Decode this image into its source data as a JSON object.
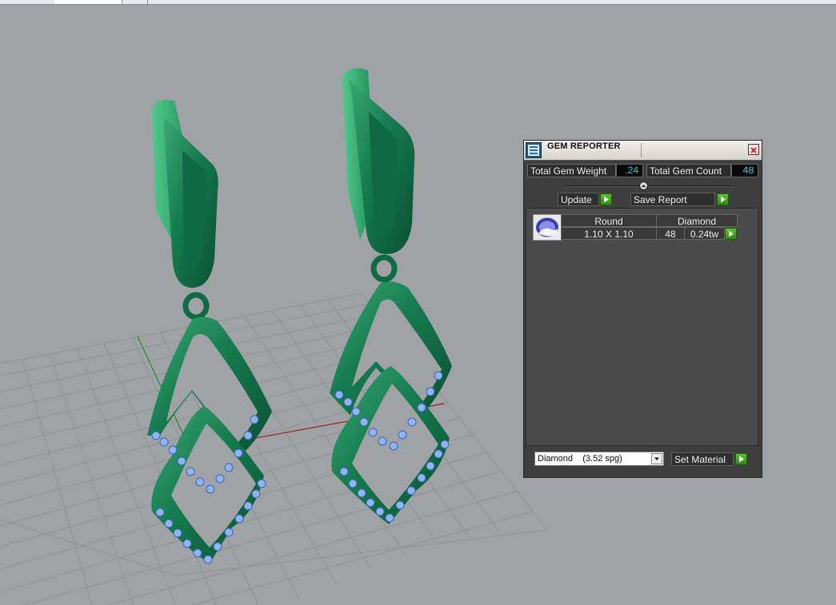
{
  "window": {
    "tabs": [
      "",
      ""
    ]
  },
  "gem_reporter": {
    "title": "GEM REPORTER",
    "close_icon": "close-icon",
    "total_weight_label": "Total Gem Weight",
    "total_weight_value": ".24",
    "total_count_label": "Total Gem Count",
    "total_count_value": "48",
    "update_label": "Update",
    "save_report_label": "Save Report",
    "table": {
      "shape_header": "Round",
      "material_header": "Diamond",
      "rows": [
        {
          "size": "1.10 X 1.10",
          "count": "48",
          "weight": "0.24tw"
        }
      ]
    },
    "material_select": {
      "value": "Diamond    (3.52 spg)"
    },
    "set_material_label": "Set Material",
    "colors": {
      "accent_value": "#35c8d2",
      "panel_bg": "#3e3e3e",
      "go_button": "#4fb32a"
    }
  }
}
